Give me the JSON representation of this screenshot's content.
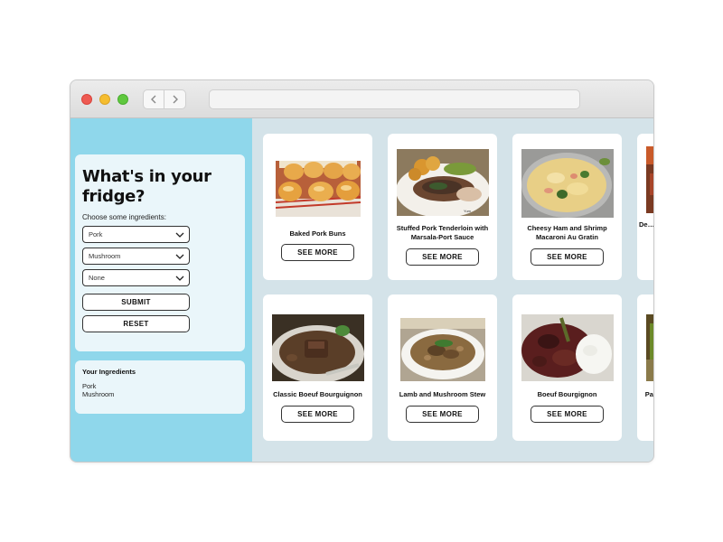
{
  "browser": {
    "address": ""
  },
  "sidebar": {
    "heading": "What's in your fridge?",
    "subheading": "Choose some ingredients:",
    "selects": [
      {
        "value": "Pork"
      },
      {
        "value": "Mushroom"
      },
      {
        "value": "None"
      }
    ],
    "submit_label": "SUBMIT",
    "reset_label": "RESET",
    "ingredients_title": "Your Ingredients",
    "ingredients": [
      "Pork",
      "Mushroom"
    ]
  },
  "recipes": [
    {
      "name": "Baked Pork Buns",
      "button": "SEE MORE"
    },
    {
      "name": "Stuffed Pork Tenderloin with Marsala-Port Sauce",
      "button": "SEE MORE"
    },
    {
      "name": "Cheesy Ham and Shrimp Macaroni Au Gratin",
      "button": "SEE MORE"
    },
    {
      "name": "De… Tende…",
      "button": ""
    },
    {
      "name": "Classic Boeuf Bourguignon",
      "button": "SEE MORE"
    },
    {
      "name": "Lamb and Mushroom Stew",
      "button": "SEE MORE"
    },
    {
      "name": "Boeuf Bourgignon",
      "button": "SEE MORE"
    },
    {
      "name": "Pan…",
      "button": ""
    }
  ],
  "colors": {
    "sidebar_bg": "#8fd7eb",
    "panel_bg": "#eaf6fa",
    "content_bg": "#d4e3e9",
    "card_bg": "#ffffff"
  }
}
